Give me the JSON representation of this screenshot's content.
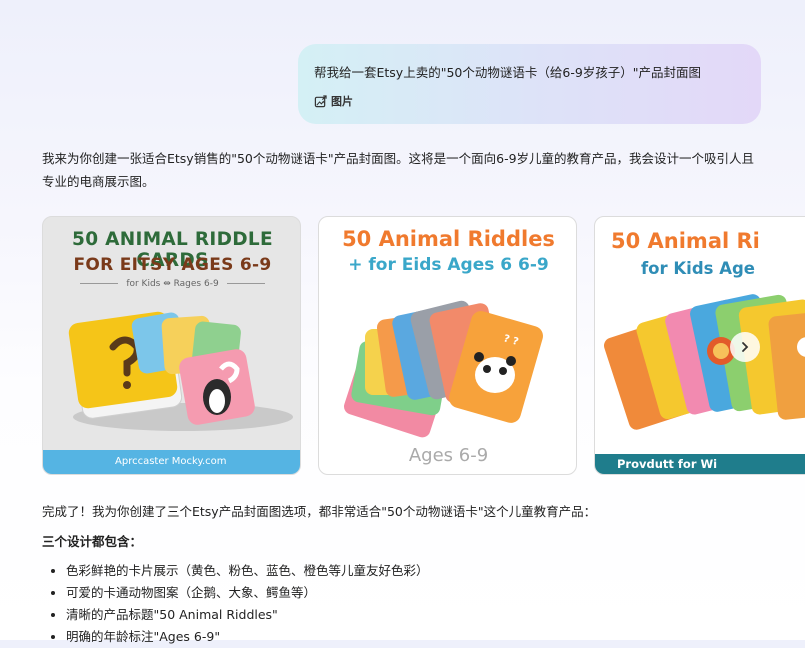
{
  "user_message": {
    "text": "帮我给一套Etsy上卖的\"50个动物谜语卡（给6-9岁孩子）\"产品封面图",
    "attachment_label": "图片"
  },
  "assistant": {
    "intro": "我来为你创建一张适合Etsy销售的\"50个动物谜语卡\"产品封面图。这将是一个面向6-9岁儿童的教育产品，我会设计一个吸引人且专业的电商展示图。",
    "images": [
      {
        "title_line1": "50 ANIMAL RIDDLE CARDS",
        "title_line2": "FOR EITSY AGES 6-9",
        "subtitle": "for Kids ⇹ Rages 6-9",
        "footer": "Aprccaster Mocky.com"
      },
      {
        "title_line1": "50 Animal Riddles",
        "title_line2": "+ for Eids Ages 6 6-9",
        "card_label": "Ages 6-9",
        "footer": "Ages 6-9"
      },
      {
        "title_line1": "50 Animal Ri",
        "title_line2": "for Kids Age",
        "footer": "Provdutt for Wi"
      }
    ],
    "next_icon": "chevron-right-icon",
    "done_text": "完成了！我为你创建了三个Etsy产品封面图选项，都非常适合\"50个动物谜语卡\"这个儿童教育产品：",
    "features_heading": "三个设计都包含：",
    "features": [
      "色彩鲜艳的卡片展示（黄色、粉色、蓝色、橙色等儿童友好色彩）",
      "可爱的卡通动物图案（企鹅、大象、鳄鱼等）",
      "清晰的产品标题\"50 Animal Riddles\"",
      "明确的年龄标注\"Ages 6-9\""
    ]
  }
}
